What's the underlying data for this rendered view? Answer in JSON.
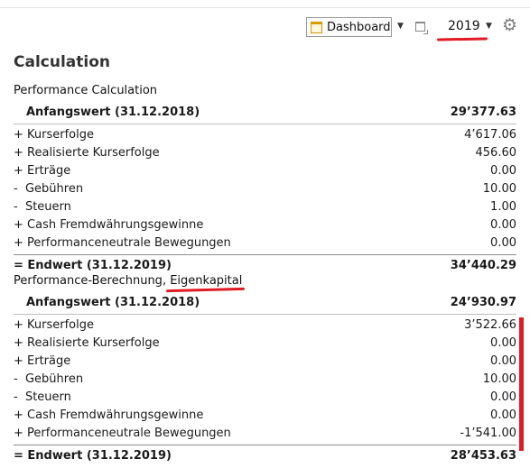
{
  "toolbar": {
    "dashboard_label": "Dashboard",
    "year_label": "2019"
  },
  "page_title": "Calculation",
  "sections": [
    {
      "heading": "Performance Calculation",
      "start": {
        "label": "Anfangswert (31.12.2018)",
        "value": "29’377.63"
      },
      "items": [
        {
          "label": "+ Kurserfolge",
          "value": "4’617.06"
        },
        {
          "label": "+ Realisierte Kurserfolge",
          "value": "456.60"
        },
        {
          "label": "+ Erträge",
          "value": "0.00"
        },
        {
          "label": "-  Gebühren",
          "value": "10.00"
        },
        {
          "label": "-  Steuern",
          "value": "1.00"
        },
        {
          "label": "+ Cash Fremdwährungsgewinne",
          "value": "0.00"
        },
        {
          "label": "+ Performanceneutrale Bewegungen",
          "value": "0.00"
        }
      ],
      "end": {
        "label": "= Endwert (31.12.2019)",
        "value": "34’440.29"
      }
    },
    {
      "heading_prefix": "Performance-Berechnung, ",
      "heading_emph": "Eigenkapital",
      "start": {
        "label": "Anfangswert (31.12.2018)",
        "value": "24’930.97"
      },
      "items": [
        {
          "label": "+ Kurserfolge",
          "value": "3’522.66"
        },
        {
          "label": "+ Realisierte Kurserfolge",
          "value": "0.00"
        },
        {
          "label": "+ Erträge",
          "value": "0.00"
        },
        {
          "label": "-  Gebühren",
          "value": "10.00"
        },
        {
          "label": "-  Steuern",
          "value": "0.00"
        },
        {
          "label": "+ Cash Fremdwährungsgewinne",
          "value": "0.00"
        },
        {
          "label": "+ Performanceneutrale Bewegungen",
          "value": "-1’541.00"
        }
      ],
      "end": {
        "label": "= Endwert (31.12.2019)",
        "value": "28’453.63"
      }
    }
  ],
  "icons": {
    "dashboard": "calendar-icon",
    "restore": "window-restore-icon",
    "settings": "gear-icon"
  },
  "colors": {
    "annotation_red": "#e01b24",
    "dashboard_icon": "#d99a00"
  }
}
